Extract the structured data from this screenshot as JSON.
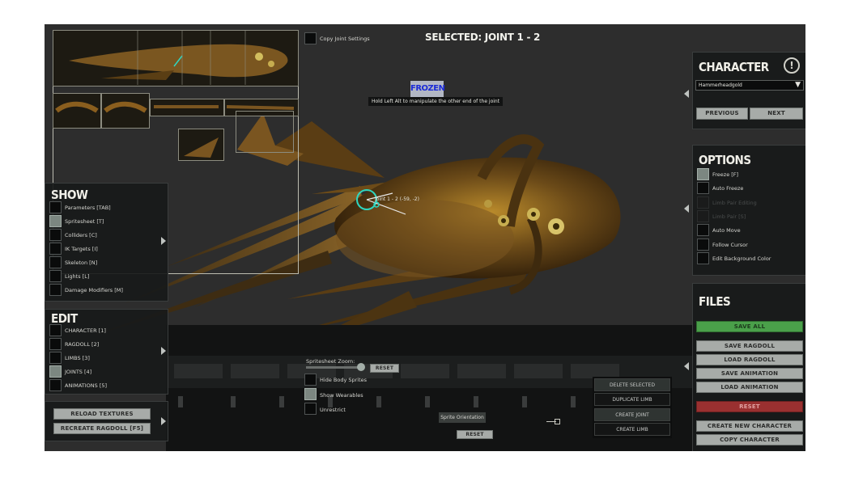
{
  "top": {
    "copy_joint_settings": "Copy Joint Settings",
    "selected_title": "SELECTED: JOINT 1 - 2",
    "frozen_badge": "FROZEN",
    "hint": "Hold Left Alt to manipulate the other end of the joint",
    "joint_label": "Joint 1 - 2 (-59, -2)"
  },
  "character": {
    "title": "CHARACTER",
    "selected": "Hammerheadgold",
    "previous": "PREVIOUS",
    "next": "NEXT"
  },
  "options": {
    "title": "OPTIONS",
    "items": [
      {
        "label": "Freeze [F]",
        "checked": true
      },
      {
        "label": "Auto Freeze",
        "checked": false
      },
      {
        "label": "Limb Pair Editing",
        "checked": false
      },
      {
        "label": "Limb Pair [S]",
        "checked": false
      },
      {
        "label": "Auto Move",
        "checked": false
      },
      {
        "label": "Follow Cursor",
        "checked": false
      },
      {
        "label": "Edit Background Color",
        "checked": false
      }
    ]
  },
  "files": {
    "title": "FILES",
    "save_all": "SAVE ALL",
    "save_ragdoll": "SAVE RAGDOLL",
    "load_ragdoll": "LOAD RAGDOLL",
    "save_animation": "SAVE ANIMATION",
    "load_animation": "LOAD ANIMATION",
    "reset": "RESET",
    "create_new_character": "CREATE NEW CHARACTER",
    "copy_character": "COPY CHARACTER"
  },
  "show": {
    "title": "SHOW",
    "items": [
      {
        "label": "Parameters [TAB]",
        "checked": false
      },
      {
        "label": "Spritesheet [T]",
        "checked": true
      },
      {
        "label": "Colliders [C]",
        "checked": false
      },
      {
        "label": "IK Targets [I]",
        "checked": false
      },
      {
        "label": "Skeleton [N]",
        "checked": false
      },
      {
        "label": "Lights [L]",
        "checked": false
      },
      {
        "label": "Damage Modifiers [M]",
        "checked": false
      }
    ]
  },
  "edit": {
    "title": "EDIT",
    "items": [
      {
        "label": "CHARACTER [1]",
        "checked": false
      },
      {
        "label": "RAGDOLL [2]",
        "checked": false
      },
      {
        "label": "LIMBS [3]",
        "checked": false
      },
      {
        "label": "JOINTS [4]",
        "checked": true
      },
      {
        "label": "ANIMATIONS [5]",
        "checked": false
      }
    ]
  },
  "bottom_left": {
    "reload_textures": "RELOAD TEXTURES",
    "recreate_ragdoll": "RECREATE RAGDOLL [F5]"
  },
  "sprite_controls": {
    "zoom_label": "Spritesheet Zoom:",
    "zoom_reset": "RESET",
    "hide_body_sprites": "Hide Body Sprites",
    "show_wearables": "Show Wearables",
    "unrestrict": "Unrestrict",
    "sprite_orientation": "Sprite Orientation",
    "orientation_reset": "RESET"
  },
  "limb_actions": {
    "delete_selected": "DELETE SELECTED",
    "duplicate_limb": "DUPLICATE LIMB",
    "create_joint": "CREATE JOINT",
    "create_limb": "CREATE LIMB"
  },
  "colors": {
    "panel_bg": "#181a1a",
    "button": "#a7aba8",
    "save_all": "#4aa04a",
    "reset": "#9a3030",
    "frozen": "#1b2bd6",
    "joint": "#2fd6c0"
  },
  "icons": {
    "info": "info-icon",
    "dropdown": "chevron-down-icon"
  }
}
